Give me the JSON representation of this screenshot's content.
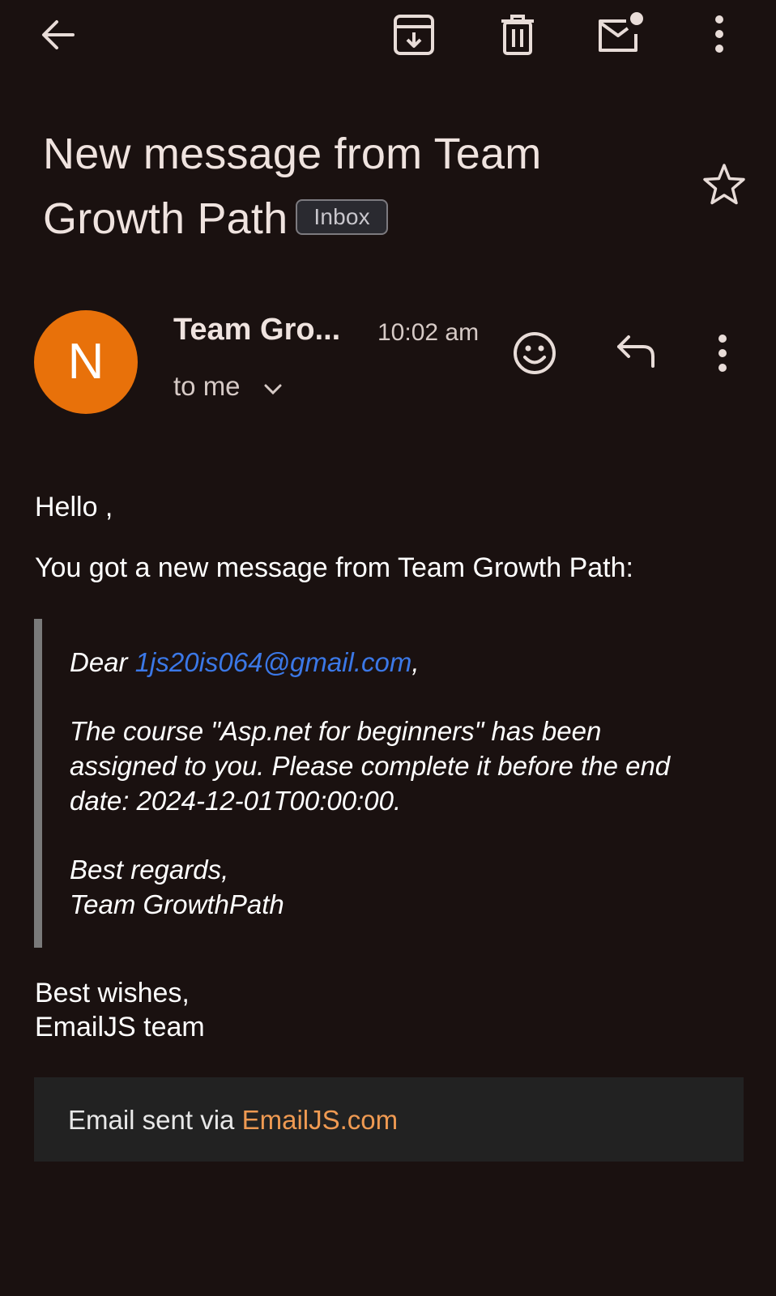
{
  "subject": {
    "text": "New message from Team Growth Path",
    "label_chip": "Inbox"
  },
  "sender": {
    "avatar_initial": "N",
    "avatar_color": "#e8710a",
    "name": "Team Gro...",
    "time": "10:02 am",
    "recipient": "to me"
  },
  "body": {
    "greeting": "Hello ,",
    "intro": "You got a new message from Team Growth Path:",
    "quote": {
      "dear_prefix": "Dear ",
      "email": "1js20is064@gmail.com",
      "dear_suffix": ",",
      "message_line1": "The course \"Asp.net for beginners\" has been",
      "message_line2": "assigned to you. Please complete it before the end",
      "message_line3": "date: 2024-12-01T00:00:00.",
      "regards": "Best regards,",
      "team": "Team GrowthPath"
    },
    "signoff_line1": "Best wishes,",
    "signoff_line2": "EmailJS team"
  },
  "footer": {
    "prefix": "Email sent via ",
    "link": "EmailJS.com"
  },
  "colors": {
    "background": "#1a1110",
    "link_blue": "#3b78e7",
    "footer_link_orange": "#ef9a52"
  },
  "icons": [
    "back-arrow-icon",
    "archive-icon",
    "delete-icon",
    "mark-unread-icon",
    "more-vert-icon",
    "star-icon",
    "emoji-icon",
    "reply-icon",
    "chevron-down-icon"
  ]
}
